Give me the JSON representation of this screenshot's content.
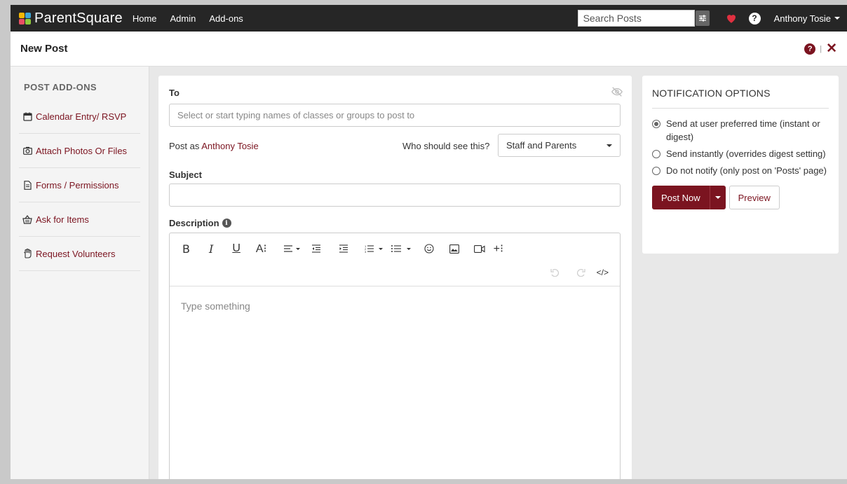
{
  "nav": {
    "brand": "ParentSquare",
    "links": [
      "Home",
      "Admin",
      "Add-ons"
    ],
    "search_placeholder": "Search Posts",
    "user": "Anthony Tosie",
    "help": "?"
  },
  "titlebar": {
    "title": "New Post",
    "help": "?",
    "separator": "|",
    "close": "✕"
  },
  "sidebar": {
    "heading": "POST ADD-ONS",
    "items": [
      {
        "label": "Calendar Entry/ RSVP",
        "icon": "calendar-icon"
      },
      {
        "label": "Attach Photos Or Files",
        "icon": "camera-icon"
      },
      {
        "label": "Forms / Permissions",
        "icon": "document-icon"
      },
      {
        "label": "Ask for Items",
        "icon": "basket-icon"
      },
      {
        "label": "Request Volunteers",
        "icon": "hand-icon"
      }
    ]
  },
  "form": {
    "to_label": "To",
    "to_placeholder": "Select or start typing names of classes or groups to post to",
    "post_as_prefix": "Post as ",
    "post_as_name": "Anthony Tosie",
    "who_label": "Who should see this?",
    "who_value": "Staff and Parents",
    "subject_label": "Subject",
    "description_label": "Description",
    "info": "i",
    "editor_placeholder": "Type something"
  },
  "toolbar": {
    "bold": "B",
    "italic": "I",
    "underline": "U",
    "font_size": "A⁝",
    "more": "+⁝",
    "code": "</>"
  },
  "notifications": {
    "title": "NOTIFICATION OPTIONS",
    "options": [
      {
        "label": "Send at user preferred time (instant or digest)",
        "checked": true
      },
      {
        "label": "Send instantly (overrides digest setting)",
        "checked": false
      },
      {
        "label": "Do not notify (only post on 'Posts' page)",
        "checked": false
      }
    ],
    "post_now": "Post Now",
    "preview": "Preview"
  },
  "colors": {
    "brand": "#7b1420",
    "nav_bg": "#262626",
    "heart": "#e03040",
    "logo": [
      "#f2b705",
      "#3fa7d6",
      "#e94f64",
      "#8fc93a"
    ]
  }
}
